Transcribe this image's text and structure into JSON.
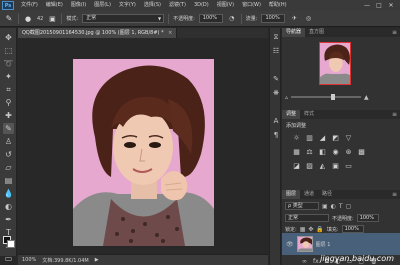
{
  "app": {
    "logo": "Ps"
  },
  "menu": [
    "文件(F)",
    "编辑(E)",
    "图像(I)",
    "图层(L)",
    "文字(Y)",
    "选择(S)",
    "滤镜(T)",
    "3D(D)",
    "视图(V)",
    "窗口(W)",
    "帮助(H)"
  ],
  "window_controls": [
    "—",
    "□",
    "✕"
  ],
  "options": {
    "brush_size": "42",
    "mode_label": "模式:",
    "mode_value": "正常",
    "opacity_label": "不透明度:",
    "opacity_value": "100%",
    "flow_label": "流量:",
    "flow_value": "100%"
  },
  "document": {
    "tab_title": "QQ截图20150901164530.jpg @ 100% (图层 1, RGB/8#) *",
    "tab_close": "×"
  },
  "status": {
    "zoom": "100%",
    "doc_info": "文档:399.8K/1.04M"
  },
  "navigator": {
    "tabs": [
      "导航器",
      "直方图"
    ],
    "panel_menu": "≡"
  },
  "adjustments": {
    "tabs": [
      "调整",
      "样式"
    ],
    "title": "添加调整",
    "panel_menu": "≡"
  },
  "layers": {
    "tabs": [
      "图层",
      "通道",
      "路径"
    ],
    "panel_menu": "≡",
    "kind_label": "ρ 类型",
    "blend_mode": "正常",
    "opacity_label": "不透明度:",
    "opacity_value": "100%",
    "lock_label": "锁定:",
    "fill_label": "填充:",
    "fill_value": "100%",
    "layer_name": "图层 1"
  },
  "watermark": "jingyan.baidu.com",
  "colors": {
    "ui_dark": "#282828",
    "panel": "#323232",
    "selected_layer": "#48607a",
    "navigator_frame": "#dd3333",
    "photo_bg": "#e6a8ce"
  }
}
